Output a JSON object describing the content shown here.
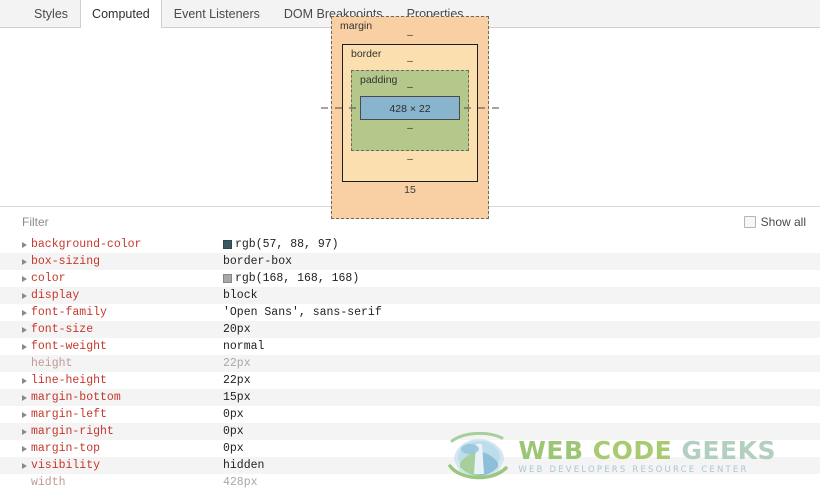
{
  "tabs": [
    {
      "label": "Styles",
      "active": false
    },
    {
      "label": "Computed",
      "active": true
    },
    {
      "label": "Event Listeners",
      "active": false
    },
    {
      "label": "DOM Breakpoints",
      "active": false
    },
    {
      "label": "Properties",
      "active": false
    }
  ],
  "box_model": {
    "margin_label": "margin",
    "margin_top": "–",
    "margin_bottom": "15",
    "margin_left": "–",
    "margin_right": "–",
    "border_label": "border",
    "border_top": "–",
    "border_bottom": "–",
    "border_left": "–",
    "border_right": "–",
    "padding_label": "padding",
    "padding_top": "–",
    "padding_bottom": "–",
    "padding_left": "–",
    "padding_right": "–",
    "content": "428 × 22",
    "colors": {
      "margin": "#f9cfa4",
      "border": "#fcdfae",
      "padding": "#b4c88b",
      "content": "#88b4ce"
    }
  },
  "filter": {
    "placeholder": "Filter",
    "value": "",
    "show_all_label": "Show all",
    "show_all_checked": false
  },
  "properties": [
    {
      "name": "background-color",
      "value": "rgb(57, 88, 97)",
      "swatch": "#395861",
      "expandable": true,
      "inherited": false
    },
    {
      "name": "box-sizing",
      "value": "border-box",
      "swatch": null,
      "expandable": true,
      "inherited": false
    },
    {
      "name": "color",
      "value": "rgb(168, 168, 168)",
      "swatch": "#a8a8a8",
      "expandable": true,
      "inherited": false
    },
    {
      "name": "display",
      "value": "block",
      "swatch": null,
      "expandable": true,
      "inherited": false
    },
    {
      "name": "font-family",
      "value": "'Open Sans', sans-serif",
      "swatch": null,
      "expandable": true,
      "inherited": false
    },
    {
      "name": "font-size",
      "value": "20px",
      "swatch": null,
      "expandable": true,
      "inherited": false
    },
    {
      "name": "font-weight",
      "value": "normal",
      "swatch": null,
      "expandable": true,
      "inherited": false
    },
    {
      "name": "height",
      "value": "22px",
      "swatch": null,
      "expandable": false,
      "inherited": true
    },
    {
      "name": "line-height",
      "value": "22px",
      "swatch": null,
      "expandable": true,
      "inherited": false
    },
    {
      "name": "margin-bottom",
      "value": "15px",
      "swatch": null,
      "expandable": true,
      "inherited": false
    },
    {
      "name": "margin-left",
      "value": "0px",
      "swatch": null,
      "expandable": true,
      "inherited": false
    },
    {
      "name": "margin-right",
      "value": "0px",
      "swatch": null,
      "expandable": true,
      "inherited": false
    },
    {
      "name": "margin-top",
      "value": "0px",
      "swatch": null,
      "expandable": true,
      "inherited": false
    },
    {
      "name": "visibility",
      "value": "hidden",
      "swatch": null,
      "expandable": true,
      "inherited": false
    },
    {
      "name": "width",
      "value": "428px",
      "swatch": null,
      "expandable": false,
      "inherited": true
    }
  ],
  "watermark": {
    "word1": "WEB",
    "word2": "CODE",
    "word3": "GEEKS",
    "subtitle": "WEB DEVELOPERS RESOURCE CENTER"
  }
}
